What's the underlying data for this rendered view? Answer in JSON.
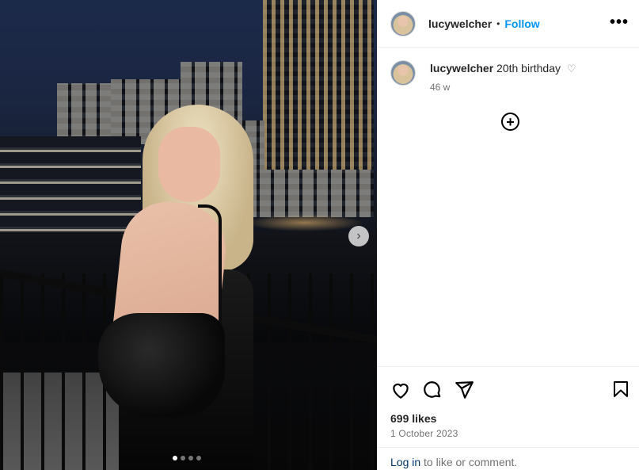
{
  "post": {
    "username": "lucywelcher",
    "separator": "•",
    "follow_label": "Follow",
    "more_label": "•••"
  },
  "caption": {
    "username": "lucywelcher",
    "text": "20th birthday",
    "heart_glyph": "♡",
    "age": "46 w"
  },
  "add_label": "+",
  "carousel": {
    "next_glyph": "›",
    "current_slide": 1,
    "total_slides": 4
  },
  "engagement": {
    "likes": "699 likes",
    "date": "1 October 2023"
  },
  "login_prompt": {
    "link": "Log in",
    "text": " to like or comment."
  },
  "icons": [
    "heart-icon",
    "comment-icon",
    "share-icon",
    "bookmark-icon",
    "add-circle-icon",
    "more-options-icon",
    "chevron-right-icon"
  ],
  "colors": {
    "accent": "#0095f6",
    "link": "#00376b",
    "muted": "#737373"
  }
}
